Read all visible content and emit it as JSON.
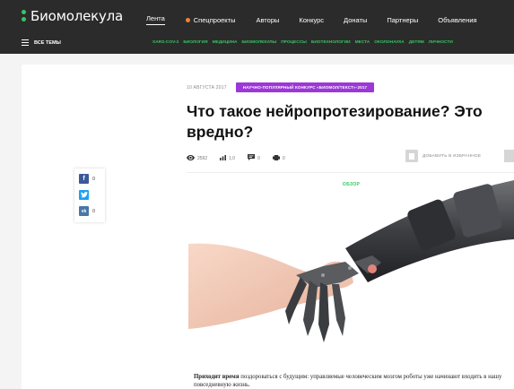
{
  "header": {
    "logo_text": "Биомолекула",
    "nav": [
      {
        "label": "Лента",
        "active": true
      },
      {
        "label": "Спецпроекты",
        "dot": true
      },
      {
        "label": "Авторы"
      },
      {
        "label": "Конкурс"
      },
      {
        "label": "Донаты"
      },
      {
        "label": "Партнеры"
      },
      {
        "label": "Объявления"
      }
    ],
    "menu_label": "ВСЕ ТЕМЫ",
    "topics": [
      "SARS-COV-2",
      "БИОЛОГИЯ",
      "МЕДИЦИНА",
      "БИОМОЛЕКУЛЫ",
      "ПРОЦЕССЫ",
      "БИОТЕХНОЛОГИИ",
      "МЕСТА",
      "ОКОЛОНАУКА",
      "ДЕТЯМ",
      "ЛИЧНОСТИ"
    ]
  },
  "share": [
    {
      "network": "facebook",
      "glyph": "f",
      "count": "0",
      "color": "#3b5998"
    },
    {
      "network": "twitter",
      "glyph": "t",
      "count": "",
      "color": "#1da1f2"
    },
    {
      "network": "vk",
      "glyph": "vk",
      "count": "0",
      "color": "#4a76a8"
    }
  ],
  "article": {
    "date": "10 АВГУСТА 2017",
    "badge": "НАУЧНО-ПОПУЛЯРНЫЙ КОНКУРС «БИОМОЛ/ТЕКСТ»-2017",
    "title": "Что такое нейропротезирование? Это вредно?",
    "stats": {
      "views": "2592",
      "rating": "1,0",
      "comments": "0",
      "printed": "0"
    },
    "favorite_label": "ДОБАВИТЬ В ИЗБРАННОЕ",
    "image_tag": "ОБЗОР",
    "lead_bold": "Приходит время",
    "lead_rest": " поздороваться с будущим: управляемые человеческим мозгом роботы уже начинают входить в нашу повседневную жизнь."
  },
  "colors": {
    "header_bg": "#2b2b2b",
    "accent_green": "#39c463",
    "badge_purple": "#9b38d6",
    "spec_dot": "#f07f3c"
  }
}
